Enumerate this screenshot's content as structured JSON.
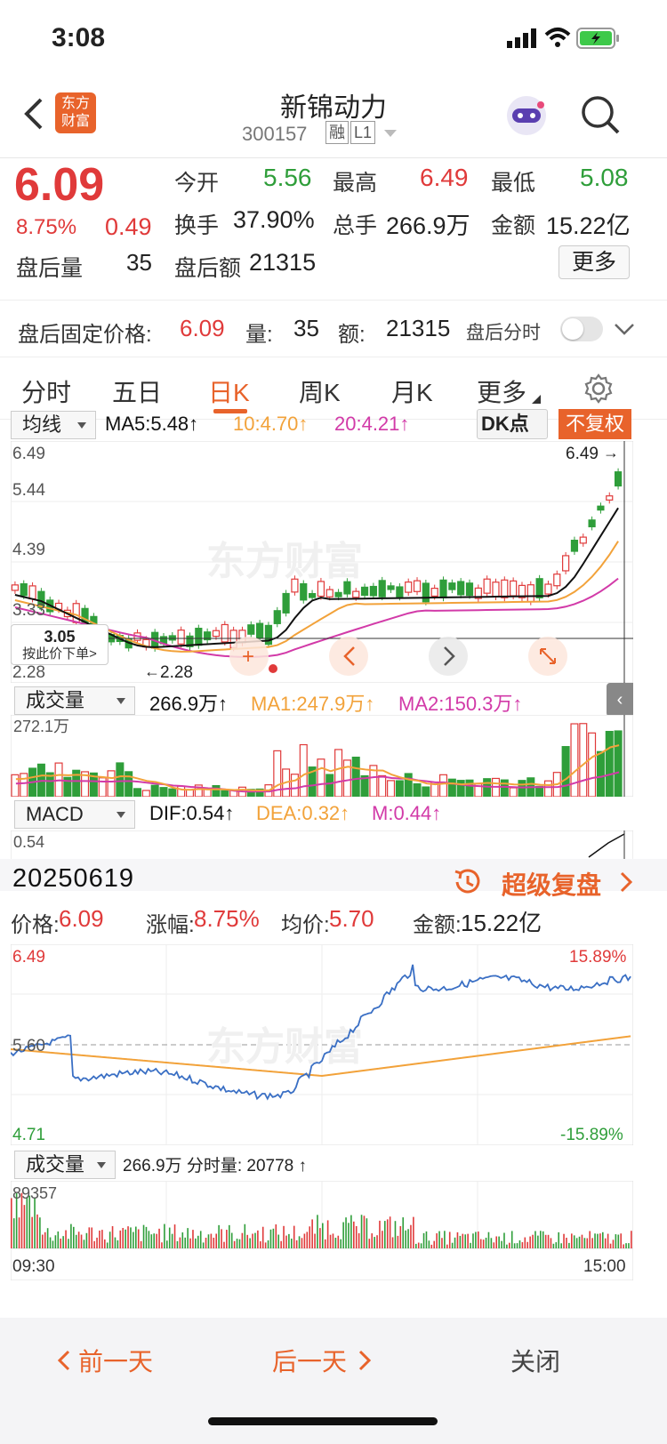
{
  "status": {
    "time": "3:08"
  },
  "header": {
    "title": "新锦动力",
    "code": "300157",
    "tag1": "融",
    "tag2": "L1",
    "logo_line1": "东方",
    "logo_line2": "财富"
  },
  "quote": {
    "price": "6.09",
    "pct": "8.75%",
    "change": "0.49",
    "open_label": "今开",
    "open": "5.56",
    "high_label": "最高",
    "high": "6.49",
    "low_label": "最低",
    "low": "5.08",
    "turnover_label": "换手",
    "turnover": "37.90%",
    "vol_label": "总手",
    "vol": "266.9万",
    "amount_label": "金额",
    "amount": "15.22亿",
    "post_vol_label": "盘后量",
    "post_vol": "35",
    "post_amt_label": "盘后额",
    "post_amt": "21315",
    "more": "更多"
  },
  "afterhours": {
    "price_label": "盘后固定价格:",
    "price": "6.09",
    "vol_label": "量:",
    "vol": "35",
    "amt_label": "额:",
    "amt": "21315",
    "intraday_label": "盘后分时"
  },
  "tabs": [
    "分时",
    "五日",
    "日K",
    "周K",
    "月K",
    "更多"
  ],
  "kline": {
    "indicator": "均线",
    "ma5": "MA5:5.48↑",
    "ma10": "10:4.70↑",
    "ma20": "20:4.21↑",
    "dk": "DK点",
    "fq": "不复权",
    "axis_top": "6.49",
    "axis_2": "5.44",
    "axis_3": "4.39",
    "axis_4": "3.33",
    "axis_bottom": "2.28",
    "high_mark": "6.49",
    "low_mark": "2.28",
    "cursor_price": "3.05",
    "cursor_text": "按此价下单>",
    "watermark": "东方财富"
  },
  "volume": {
    "indicator": "成交量",
    "value": "266.9万↑",
    "ma1": "MA1:247.9万↑",
    "ma2": "MA2:150.3万↑",
    "axis_top": "272.1万"
  },
  "macd": {
    "indicator": "MACD",
    "dif": "DIF:0.54↑",
    "dea": "DEA:0.32↑",
    "m": "M:0.44↑",
    "axis_top": "0.54"
  },
  "day": {
    "date": "20250619",
    "replay": "超级复盘",
    "price_label": "价格:",
    "price": "6.09",
    "pct_label": "涨幅:",
    "pct": "8.75%",
    "avg_label": "均价:",
    "avg": "5.70",
    "amt_label": "金额:",
    "amt": "15.22亿",
    "axis_top": "6.49",
    "axis_mid": "5.60",
    "axis_bottom": "4.71",
    "pct_top": "15.89%",
    "pct_bottom": "-15.89%",
    "vol_indicator": "成交量",
    "vol_text": "266.9万 分时量: 20778 ↑",
    "vol_axis": "89357",
    "time_start": "09:30",
    "time_end": "15:00",
    "watermark": "东方财富"
  },
  "bottomnav": {
    "prev": "前一天",
    "next": "后一天",
    "close": "关闭"
  },
  "colors": {
    "up": "#e03a3a",
    "down": "#2f9e3a",
    "ma5": "#111111",
    "ma10": "#f2a23a",
    "ma20": "#d23aa8",
    "accent": "#e8632b"
  }
}
